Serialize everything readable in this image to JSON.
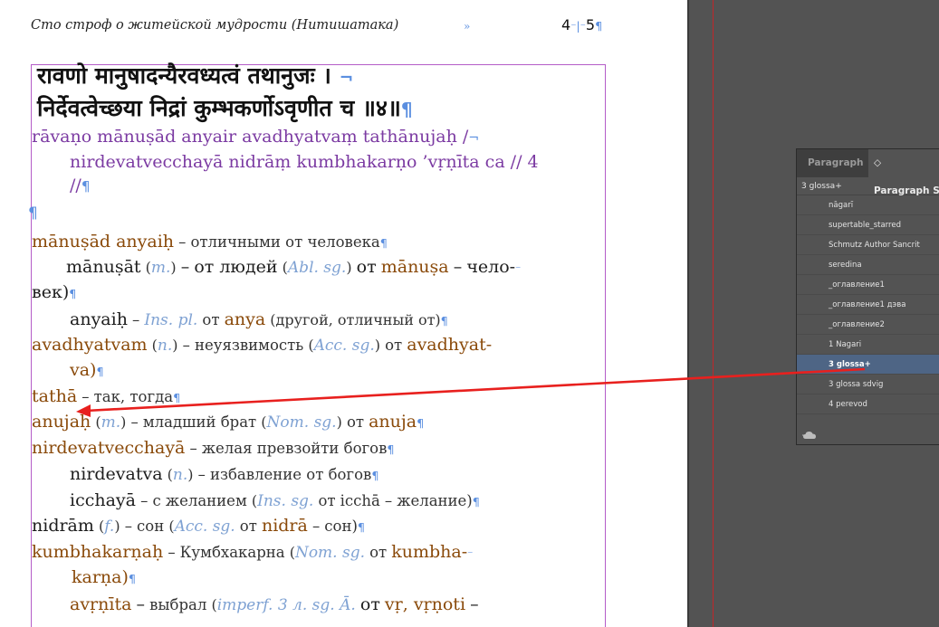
{
  "document": {
    "running_head": "Сто строф о житейской мудрости (Нитишатака)",
    "head_marker": "»",
    "page_number": "4",
    "page_number_sep": "⁻|⁻",
    "page_number_total": "5"
  },
  "verse": {
    "deva_line1": "रावणो मानुषादन्यैरवध्यत्वं तथानुजः ।",
    "deva_line2": "निर्देवत्वेच्छया निद्रां कुम्भकर्णोऽवृणीत च ॥४॥",
    "iast_line1": "rāvaṇo mānuṣād anyair avadhyatvaṃ tathānujaḥ /",
    "iast_line2": "nirdevatvecchayā nidrāṃ kumbhakarṇo ’vṛṇīta ca // 4",
    "iast_line3": "//"
  },
  "glossary": [
    {
      "term": "mānuṣād anyaiḥ",
      "dash": "–",
      "ru": "отличными от человека"
    },
    {
      "word": "mānuṣāt",
      "paren_open": "(",
      "gram": "m.",
      "paren_close": ")",
      "dash": "–",
      "ru": "от людей",
      "gram2": "Abl. sg.",
      "ot": "от",
      "term2": "mānuṣa",
      "dash2": "–",
      "ru_cont": "чело-",
      "ru_wrap": "век)"
    },
    {
      "word": "anyaiḥ",
      "dash": "–",
      "gram": "Ins. pl.",
      "ot": "от",
      "term2": "anya",
      "paren": "(другой, отличный от)"
    },
    {
      "term": "avadhyatvam",
      "gram": "n.",
      "dash": "–",
      "ru": "неуязвимость",
      "gram2": "Acc. sg.",
      "ot": "от",
      "term2": "avadhyat-",
      "wrap": "va)"
    },
    {
      "term": "tathā",
      "dash": "–",
      "ru": "так, тогда"
    },
    {
      "term": "anujaḥ",
      "gram": "m.",
      "dash": "–",
      "ru": "младший брат",
      "gram2": "Nom. sg.",
      "ot": "от",
      "term2": "anuja"
    },
    {
      "term": "nirdevatvecchayā",
      "dash": "–",
      "ru": "желая превзойти богов"
    },
    {
      "word": "nirdevatva",
      "gram": "n.",
      "dash": "–",
      "ru": "избавление от богов"
    },
    {
      "word": "icchayā",
      "dash": "–",
      "ru": "с желанием",
      "gram2": "Ins. sg.",
      "ot": "от",
      "word2": "icchā",
      "dash2": "–",
      "ru2": "желание)"
    },
    {
      "word": "nidrām",
      "gram": "f.",
      "dash": "–",
      "ru": "сон",
      "gram2": "Acc. sg.",
      "ot": "от",
      "term2": "nidrā",
      "dash2": "–",
      "ru2": "сон)"
    },
    {
      "term": "kumbhakarṇaḥ",
      "dash": "–",
      "ru": "Кумбхакарна",
      "gram2": "Nom. sg.",
      "ot": "от",
      "term2": "kumbha-",
      "wrap": "karṇa)"
    },
    {
      "term": "avṛṇīta",
      "dash": "–",
      "ru": "выбрал",
      "gram2": "imperf. 3 л. sg. Ā.",
      "ot": "от",
      "term2": "vṛ, vṛṇoti",
      "dash2": "–"
    }
  ],
  "marks": {
    "pilcrow": "¶",
    "hyphen_mark": "⁻",
    "line_break_mark": "¬",
    "paren_open": "(",
    "paren_close": ")"
  },
  "panel": {
    "tab_paragraph": "Paragraph",
    "tab_paragraph_styles": "◇ Paragraph S",
    "current_style": "3 glossa+",
    "styles": [
      "nāgarī",
      "supertable_starred",
      "Schmutz Author Sancrit",
      "seredina",
      "_оглавление1",
      "_оглавление1 дэва",
      "_оглавление2",
      "1 Nagari",
      "3 glossa+",
      "3 glossa sdvig",
      "4 perevod"
    ],
    "selected_style": "3 glossa+",
    "cloud_icon": "creative-cloud-icon"
  },
  "annotation": {
    "arrow_color": "#e8201e"
  }
}
